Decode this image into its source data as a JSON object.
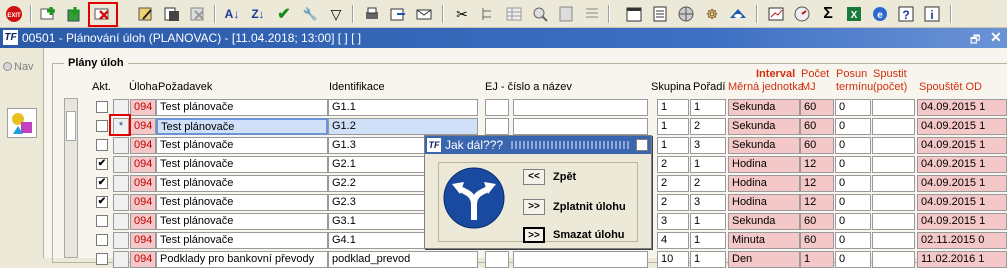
{
  "toolbar": {
    "icons": [
      "exit-icon",
      "add-record-icon",
      "add-copy-icon",
      "delete-record-icon",
      "edit-icon",
      "copy-icon",
      "cut-icon",
      "sort-asc-icon",
      "sort-desc-icon",
      "check-icon",
      "tools-icon",
      "filter-icon",
      "print-icon",
      "export-icon",
      "mail-icon",
      "scissors-icon",
      "tree-icon",
      "grid-icon",
      "search-icon",
      "calc-icon",
      "list-icon",
      "calendar-icon",
      "database-icon",
      "globe-icon",
      "helm-icon",
      "eye-icon",
      "chart-icon",
      "sum-icon",
      "excel-icon",
      "ie-icon",
      "help-icon",
      "info-icon"
    ],
    "exit_label": "EXIT"
  },
  "window": {
    "title": "00501 - Plánování úloh (PLANOVAC) - [11.04.2018; 13:00]  [ ]  [ ]",
    "logo": "TF"
  },
  "nav": {
    "label": "Nav"
  },
  "group": {
    "title": "Plány úloh"
  },
  "headers": {
    "akt": "Akt.",
    "uloha": "Úloha",
    "pozadavek": "Požadavek",
    "identifikace": "Identifikace",
    "ej": "EJ - číslo a název",
    "skupina": "Skupina",
    "poradi": "Pořadí",
    "interval": "Interval",
    "merna": "Měrná jednotka",
    "pocet": "Počet",
    "mj": "MJ",
    "posun": "Posun",
    "terminu": "termínu",
    "spustit": "Spustit",
    "pocet2": "(počet)",
    "spoustet": "Spouštět OD"
  },
  "rows": [
    {
      "checked": false,
      "uloha": "094",
      "pozadavek": "Test plánovače",
      "ident": "G1.1",
      "skupina": "1",
      "poradi": "1",
      "jednotka": "Sekunda",
      "pocet": "60",
      "posun": "0",
      "spoustet": "04.09.2015 1"
    },
    {
      "checked": false,
      "uloha": "094",
      "pozadavek": "Test plánovače",
      "ident": "G1.2",
      "skupina": "1",
      "poradi": "2",
      "jednotka": "Sekunda",
      "pocet": "60",
      "posun": "0",
      "spoustet": "04.09.2015 1",
      "selected": true,
      "marker": "*"
    },
    {
      "checked": false,
      "uloha": "094",
      "pozadavek": "Test plánovače",
      "ident": "G1.3",
      "skupina": "1",
      "poradi": "3",
      "jednotka": "Sekunda",
      "pocet": "60",
      "posun": "0",
      "spoustet": "04.09.2015 1"
    },
    {
      "checked": true,
      "uloha": "094",
      "pozadavek": "Test plánovače",
      "ident": "G2.1",
      "skupina": "2",
      "poradi": "1",
      "jednotka": "Hodina",
      "pocet": "12",
      "posun": "0",
      "spoustet": "04.09.2015 1"
    },
    {
      "checked": true,
      "uloha": "094",
      "pozadavek": "Test plánovače",
      "ident": "G2.2",
      "skupina": "2",
      "poradi": "2",
      "jednotka": "Hodina",
      "pocet": "12",
      "posun": "0",
      "spoustet": "04.09.2015 1"
    },
    {
      "checked": true,
      "uloha": "094",
      "pozadavek": "Test plánovače",
      "ident": "G2.3",
      "skupina": "2",
      "poradi": "3",
      "jednotka": "Hodina",
      "pocet": "12",
      "posun": "0",
      "spoustet": "04.09.2015 1"
    },
    {
      "checked": false,
      "uloha": "094",
      "pozadavek": "Test plánovače",
      "ident": "G3.1",
      "skupina": "3",
      "poradi": "1",
      "jednotka": "Sekunda",
      "pocet": "60",
      "posun": "0",
      "spoustet": "04.09.2015 1"
    },
    {
      "checked": false,
      "uloha": "094",
      "pozadavek": "Test plánovače",
      "ident": "G4.1",
      "skupina": "4",
      "poradi": "1",
      "jednotka": "Minuta",
      "pocet": "60",
      "posun": "0",
      "spoustet": "02.11.2015 0"
    },
    {
      "checked": false,
      "uloha": "094",
      "pozadavek": "Podklady pro bankovní převody",
      "ident": "podklad_prevod",
      "skupina": "10",
      "poradi": "1",
      "jednotka": "Den",
      "pocet": "1",
      "posun": "0",
      "spoustet": "11.02.2016 1"
    }
  ],
  "dialog": {
    "title": "Jak dál???",
    "logo": "TF",
    "buttons": [
      {
        "symbol": "<<",
        "label": "Zpět"
      },
      {
        "symbol": ">>",
        "label": "Zplatnit úlohu"
      },
      {
        "symbol": ">>",
        "label": "Smazat úlohu"
      }
    ]
  }
}
